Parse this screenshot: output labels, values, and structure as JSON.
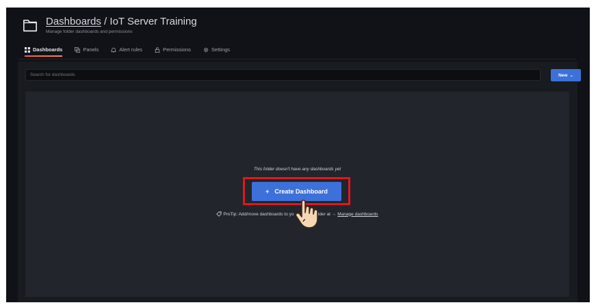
{
  "header": {
    "breadcrumb_root": "Dashboards",
    "separator": " / ",
    "folder_name": "IoT Server Training",
    "subtitle": "Manage folder dashboards and permissions"
  },
  "tabs": [
    {
      "label": "Dashboards",
      "icon": "apps-icon",
      "active": true
    },
    {
      "label": "Panels",
      "icon": "library-panels-icon",
      "active": false
    },
    {
      "label": "Alert rules",
      "icon": "bell-icon",
      "active": false
    },
    {
      "label": "Permissions",
      "icon": "lock-icon",
      "active": false
    },
    {
      "label": "Settings",
      "icon": "cog-icon",
      "active": false
    }
  ],
  "search": {
    "placeholder": "Search for dashboards"
  },
  "new_button": {
    "label": "New",
    "caret": "⌄"
  },
  "empty_state": {
    "message": "This folder doesn't have any dashboards yet",
    "create_button_label": "Create Dashboard",
    "create_button_icon": "+",
    "protip_prefix": "ProTip: Add/move dashboards to yo",
    "protip_middle": "r folder at →",
    "protip_link": "Manage dashboards"
  },
  "colors": {
    "accent": "#3d71d9",
    "highlight": "#e0181d",
    "tab_underline": "#f55f3e",
    "background": "#111217"
  }
}
